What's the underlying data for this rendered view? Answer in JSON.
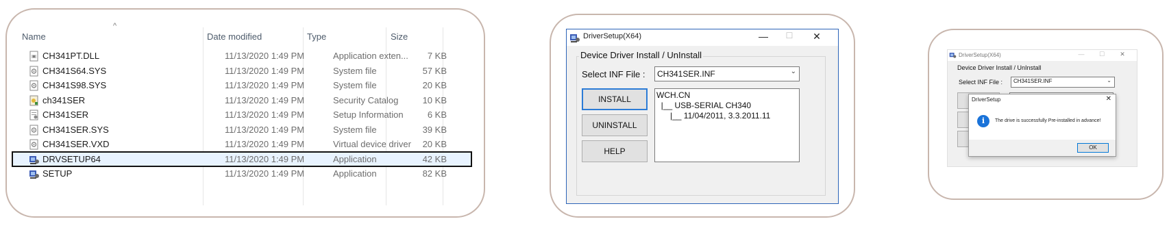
{
  "explorer": {
    "columns": {
      "name": "Name",
      "date": "Date modified",
      "type": "Type",
      "size": "Size"
    },
    "files": [
      {
        "name": "CH341PT.DLL",
        "date": "11/13/2020 1:49 PM",
        "type": "Application exten...",
        "size": "7 KB",
        "icon": "dll-file-icon"
      },
      {
        "name": "CH341S64.SYS",
        "date": "11/13/2020 1:49 PM",
        "type": "System file",
        "size": "57 KB",
        "icon": "system-file-icon"
      },
      {
        "name": "CH341S98.SYS",
        "date": "11/13/2020 1:49 PM",
        "type": "System file",
        "size": "20 KB",
        "icon": "system-file-icon"
      },
      {
        "name": "ch341SER",
        "date": "11/13/2020 1:49 PM",
        "type": "Security Catalog",
        "size": "10 KB",
        "icon": "security-catalog-icon"
      },
      {
        "name": "CH341SER",
        "date": "11/13/2020 1:49 PM",
        "type": "Setup Information",
        "size": "6 KB",
        "icon": "setup-info-icon"
      },
      {
        "name": "CH341SER.SYS",
        "date": "11/13/2020 1:49 PM",
        "type": "System file",
        "size": "39 KB",
        "icon": "system-file-icon"
      },
      {
        "name": "CH341SER.VXD",
        "date": "11/13/2020 1:49 PM",
        "type": "Virtual device driver",
        "size": "20 KB",
        "icon": "system-file-icon"
      },
      {
        "name": "DRVSETUP64",
        "date": "11/13/2020 1:49 PM",
        "type": "Application",
        "size": "42 KB",
        "icon": "setup-app-icon",
        "selected": true
      },
      {
        "name": "SETUP",
        "date": "11/13/2020 1:49 PM",
        "type": "Application",
        "size": "82 KB",
        "icon": "setup-app-icon"
      }
    ]
  },
  "driver_window": {
    "title": "DriverSetup(X64)",
    "group_label": "Device Driver Install / UnInstall",
    "inf_label": "Select INF File :",
    "inf_value": "CH341SER.INF",
    "install_label": "INSTALL",
    "uninstall_label": "UNINSTALL",
    "help_label": "HELP",
    "info_lines": [
      "WCH.CN",
      "  |__ USB-SERIAL CH340",
      "      |__ 11/04/2011, 3.3.2011.11"
    ],
    "minimize_glyph": "—",
    "maximize_glyph": "☐",
    "close_glyph": "✕"
  },
  "dialog_screenshot": {
    "title": "DriverSetup(X64)",
    "group_label": "Device Driver Install / UnInstall",
    "inf_label": "Select INF File :",
    "inf_value": "CH341SER.INF",
    "dialog_title": "DriverSetup",
    "message": "The drive is successfully Pre-installed in advance!",
    "ok_label": "OK",
    "close_glyph": "✕",
    "info_glyph": "i"
  },
  "colors": {
    "frame_border": "#c8b6ad",
    "selection": "#e8f3ff",
    "window_border": "#2b63b8",
    "info_blue": "#1a73d9"
  }
}
